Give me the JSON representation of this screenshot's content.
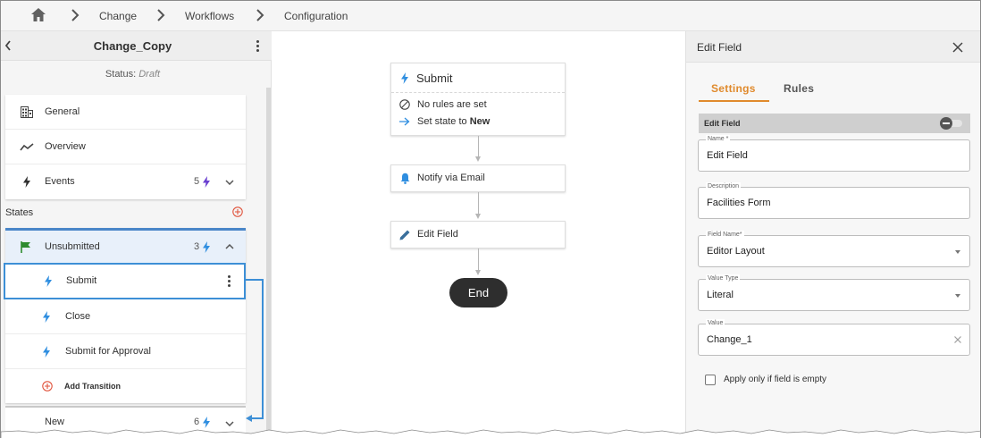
{
  "breadcrumb": {
    "home_icon": "home-icon",
    "items": [
      "Change",
      "Workflows",
      "Configuration"
    ]
  },
  "workflow": {
    "name": "Change_Copy",
    "status_label": "Status:",
    "status_value": "Draft"
  },
  "nav": {
    "general": "General",
    "overview": "Overview",
    "events": {
      "label": "Events",
      "count": "5"
    }
  },
  "states": {
    "label": "States",
    "unsubmitted": {
      "label": "Unsubmitted",
      "count": "3"
    },
    "transitions": [
      "Submit",
      "Close",
      "Submit for Approval"
    ],
    "add_transition": "Add Transition",
    "new": {
      "label": "New",
      "count": "6"
    }
  },
  "canvas": {
    "submit_node": {
      "title": "Submit",
      "rule_text": "No rules are set",
      "state_prefix": "Set state to ",
      "state_value": "New"
    },
    "notify_node": "Notify via Email",
    "edit_node": "Edit Field",
    "end_label": "End"
  },
  "panel": {
    "title": "Edit Field",
    "tabs": [
      "Settings",
      "Rules"
    ],
    "section": "Edit Field",
    "fields": {
      "name": {
        "label": "Name *",
        "value": "Edit Field"
      },
      "description": {
        "label": "Description",
        "value": "Facilities Form"
      },
      "field_name": {
        "label": "Field Name*",
        "value": "Editor Layout"
      },
      "value_type": {
        "label": "Value Type",
        "value": "Literal"
      },
      "value": {
        "label": "Value",
        "value": "Change_1"
      }
    },
    "checkbox_label": "Apply only if field is empty"
  },
  "colors": {
    "accent_tab": "#e08a2c",
    "selection_blue": "#3d8fd6",
    "bolt_blue": "#2f8ee0",
    "bolt_purple": "#6a3fd0",
    "flag_green": "#2e8b2e",
    "add_red": "#e0533c",
    "end_pill": "#2e2e2e"
  }
}
